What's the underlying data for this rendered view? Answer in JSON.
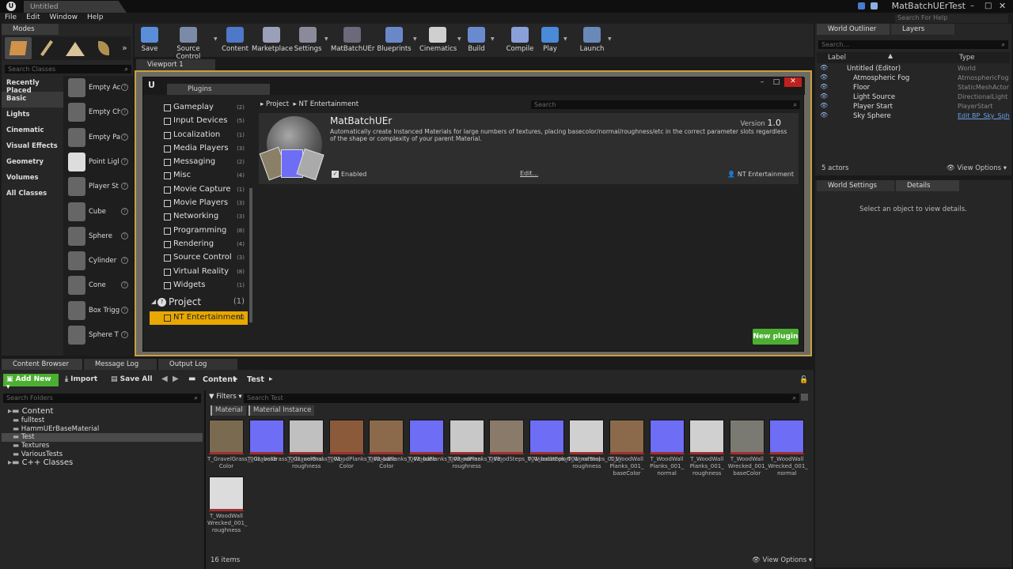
{
  "window": {
    "doc_tab": "Untitled",
    "app_title": "MatBatchUErTest",
    "search_help_placeholder": "Search For Help"
  },
  "menu": [
    "File",
    "Edit",
    "Window",
    "Help"
  ],
  "modes": {
    "tab": "Modes",
    "search_placeholder": "Search Classes",
    "categories": [
      "Recently Placed",
      "Basic",
      "Lights",
      "Cinematic",
      "Visual Effects",
      "Geometry",
      "Volumes",
      "All Classes"
    ],
    "items": [
      "Empty Ac",
      "Empty Ch",
      "Empty Pa",
      "Point Ligl",
      "Player St",
      "Cube",
      "Sphere",
      "Cylinder",
      "Cone",
      "Box Trigg",
      "Sphere T"
    ]
  },
  "toolbar": [
    "Save",
    "Source Control",
    "Content",
    "Marketplace",
    "Settings",
    "MatBatchUEr",
    "Blueprints",
    "Cinematics",
    "Build",
    "Compile",
    "Play",
    "Launch"
  ],
  "viewport_tab": "Viewport 1",
  "plugins": {
    "tab": "Plugins",
    "breadcrumb": [
      "Project",
      "NT Entertainment"
    ],
    "search_placeholder": "Search",
    "categories": [
      {
        "name": "Gameplay",
        "count": "(2)"
      },
      {
        "name": "Input Devices",
        "count": "(5)"
      },
      {
        "name": "Localization",
        "count": "(1)"
      },
      {
        "name": "Media Players",
        "count": "(3)"
      },
      {
        "name": "Messaging",
        "count": "(2)"
      },
      {
        "name": "Misc",
        "count": "(4)"
      },
      {
        "name": "Movie Capture",
        "count": "(1)"
      },
      {
        "name": "Movie Players",
        "count": "(3)"
      },
      {
        "name": "Networking",
        "count": "(3)"
      },
      {
        "name": "Programming",
        "count": "(8)"
      },
      {
        "name": "Rendering",
        "count": "(4)"
      },
      {
        "name": "Source Control",
        "count": "(3)"
      },
      {
        "name": "Virtual Reality",
        "count": "(8)"
      },
      {
        "name": "Widgets",
        "count": "(1)"
      }
    ],
    "project": {
      "label": "Project",
      "count": "(1)"
    },
    "selected": {
      "label": "NT Entertainment",
      "count": "(1)"
    },
    "plugin": {
      "name": "MatBatchUEr",
      "version_label": "Version",
      "version": "1.0",
      "description": "Automatically create Instanced Materials for large numbers of textures, placing basecolor/normal/roughness/etc in the correct parameter slots regardless of the shape or complexity of your parent Material.",
      "enabled_label": "Enabled",
      "edit_label": "Edit...",
      "author": "NT Entertainment"
    },
    "new_plugin": "New plugin"
  },
  "outliner": {
    "tabs": [
      "World Outliner",
      "Layers"
    ],
    "search_placeholder": "Search...",
    "col_label": "Label",
    "col_type": "Type",
    "rows": [
      {
        "label": "Untitled (Editor)",
        "type": "World"
      },
      {
        "label": "Atmospheric Fog",
        "type": "AtmosphericFog"
      },
      {
        "label": "Floor",
        "type": "StaticMeshActor"
      },
      {
        "label": "Light Source",
        "type": "DirectionalLight"
      },
      {
        "label": "Player Start",
        "type": "PlayerStart"
      },
      {
        "label": "Sky Sphere",
        "type": "Edit BP_Sky_Sph"
      }
    ],
    "count": "5 actors",
    "view_options": "View Options"
  },
  "details": {
    "tabs": [
      "World Settings",
      "Details"
    ],
    "empty": "Select an object to view details."
  },
  "bottom_tabs": [
    "Content Browser",
    "Message Log",
    "Output Log"
  ],
  "content": {
    "add_new": "Add New",
    "import": "Import",
    "save_all": "Save All",
    "path": [
      "Content",
      "Test"
    ],
    "search_folders": "Search Folders",
    "filters": "Filters",
    "search_test": "Search Test",
    "filter_chips": [
      "Material",
      "Material Instance"
    ],
    "tree": [
      {
        "label": "Content",
        "level": 0
      },
      {
        "label": "fulltest",
        "level": 1
      },
      {
        "label": "HammUErBaseMaterial",
        "level": 1
      },
      {
        "label": "Test",
        "level": 1
      },
      {
        "label": "Textures",
        "level": 1
      },
      {
        "label": "VariousTests",
        "level": 1
      },
      {
        "label": "C++ Classes",
        "level": 0
      }
    ],
    "assets": [
      "T_GravelGrass_001_base Color",
      "T_GravelGrass_001_normal",
      "T_GravelGrass_001_ roughness",
      "T_WoodPlanks_002_base Color",
      "T_WoodPlanks_003_base Color",
      "T_WoodPlanks_003_normal",
      "T_WoodPlanks_003_ roughness",
      "T_WoodSteps_001_baseColor",
      "T_WoodSteps_001_normal",
      "T_WoodSteps_001_ roughness",
      "T_WoodWall Planks_001_ baseColor",
      "T_WoodWall Planks_001_ normal",
      "T_WoodWall Planks_001_ roughness",
      "T_WoodWall Wrecked_001_ baseColor",
      "T_WoodWall Wrecked_001_ normal",
      "T_WoodWall Wrecked_001_ roughness"
    ],
    "item_count": "16 items",
    "view_options": "View Options"
  },
  "colors": {
    "accent": "#e8a800",
    "green": "#4caf32",
    "normal": "#6d6df5"
  }
}
